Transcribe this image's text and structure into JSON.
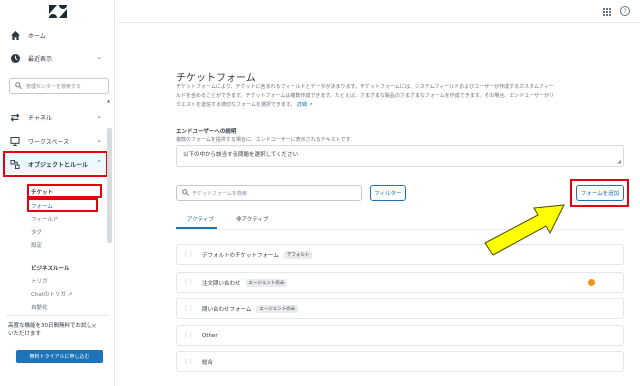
{
  "sidebar": {
    "home": "ホーム",
    "recent": "最近表示",
    "search_placeholder": "管理センターを検索する",
    "channels": "チャネル",
    "workspaces": "ワークスペース",
    "objects_rules": "オブジェクトとルール",
    "tickets_header": "チケット",
    "items": [
      "フォーム",
      "フィールド",
      "タグ",
      "設定"
    ],
    "business_rules_header": "ビジネスルール",
    "business_items": [
      "トリガ",
      "Chatのトリガ",
      "自動化"
    ],
    "promo_text": "高度な機能を30日間無料でお試しいただけます",
    "promo_button": "無料トライアルに申し込む"
  },
  "main": {
    "title": "チケットフォーム",
    "description": "チケットフォームにより、チケットに含まれるフィールドとデータが決まります。チケットフォームには、システムフィールドおよびユーザーが作成するカスタムフィールドを含めることができます。チケットフォームは複数作成できます。たとえば、さまざまな製品のさまざまなフォームを作成できます。その場合、エンドユーザーがリクエストを送信する適切なフォームを選択できます。",
    "details_link": "詳細",
    "enduser_label": "エンドユーザーへの説明",
    "enduser_hint": "複数のフォームを提供する場合に、エンドユーザーに表示されるテキストです",
    "enduser_value": "以下の中から該当する問題を選択してください",
    "search_placeholder": "チケットフォームを検索",
    "filter_button": "フィルター",
    "add_button": "フォームを追加",
    "tabs": [
      "アクティブ",
      "非アクティブ"
    ],
    "forms": [
      {
        "name": "デフォルトのチケットフォーム",
        "badge": "デフォルト"
      },
      {
        "name": "注文問い合わせ",
        "badge": "エージェントのみ"
      },
      {
        "name": "問い合わせフォーム",
        "badge": "エージェントのみ"
      },
      {
        "name": "Other",
        "badge": ""
      },
      {
        "name": "総合",
        "badge": ""
      }
    ]
  },
  "colors": {
    "accent": "#1f73b7",
    "highlight": "#e3000f",
    "arrow": "#ffff00",
    "warning": "#ed961c"
  }
}
